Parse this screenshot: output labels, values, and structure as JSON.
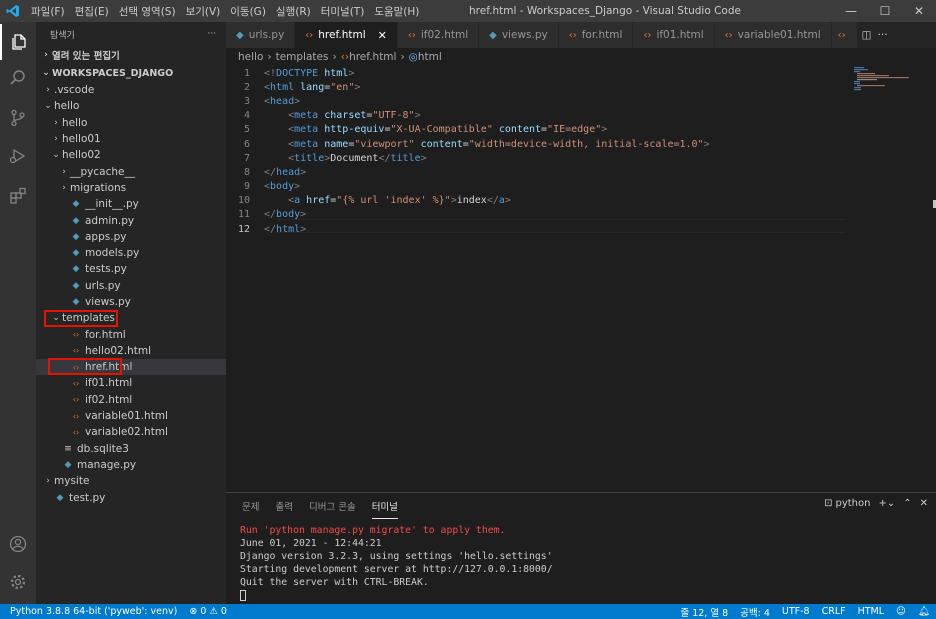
{
  "window": {
    "title": "href.html - Workspaces_Django - Visual Studio Code",
    "menu": [
      "파일(F)",
      "편집(E)",
      "선택 영역(S)",
      "보기(V)",
      "이동(G)",
      "실행(R)",
      "터미널(T)",
      "도움말(H)"
    ]
  },
  "sidebar": {
    "header": "탐색기",
    "more": "···",
    "open_editors": "열려 있는 편집기",
    "workspace": "WORKSPACES_DJANGO",
    "tree": [
      {
        "label": ".vscode",
        "depth": 0,
        "kind": "folder",
        "open": false
      },
      {
        "label": "hello",
        "depth": 0,
        "kind": "folder",
        "open": true
      },
      {
        "label": "hello",
        "depth": 1,
        "kind": "folder",
        "open": false
      },
      {
        "label": "hello01",
        "depth": 1,
        "kind": "folder",
        "open": false
      },
      {
        "label": "hello02",
        "depth": 1,
        "kind": "folder",
        "open": true
      },
      {
        "label": "__pycache__",
        "depth": 2,
        "kind": "folder",
        "open": false
      },
      {
        "label": "migrations",
        "depth": 2,
        "kind": "folder",
        "open": false
      },
      {
        "label": "__init__.py",
        "depth": 2,
        "kind": "py"
      },
      {
        "label": "admin.py",
        "depth": 2,
        "kind": "py"
      },
      {
        "label": "apps.py",
        "depth": 2,
        "kind": "py"
      },
      {
        "label": "models.py",
        "depth": 2,
        "kind": "py"
      },
      {
        "label": "tests.py",
        "depth": 2,
        "kind": "py"
      },
      {
        "label": "urls.py",
        "depth": 2,
        "kind": "py"
      },
      {
        "label": "views.py",
        "depth": 2,
        "kind": "py"
      },
      {
        "label": "templates",
        "depth": 1,
        "kind": "folder",
        "open": true
      },
      {
        "label": "for.html",
        "depth": 2,
        "kind": "html"
      },
      {
        "label": "hello02.html",
        "depth": 2,
        "kind": "html"
      },
      {
        "label": "href.html",
        "depth": 2,
        "kind": "html",
        "selected": true
      },
      {
        "label": "if01.html",
        "depth": 2,
        "kind": "html"
      },
      {
        "label": "if02.html",
        "depth": 2,
        "kind": "html"
      },
      {
        "label": "variable01.html",
        "depth": 2,
        "kind": "html"
      },
      {
        "label": "variable02.html",
        "depth": 2,
        "kind": "html"
      },
      {
        "label": "db.sqlite3",
        "depth": 1,
        "kind": "db"
      },
      {
        "label": "manage.py",
        "depth": 1,
        "kind": "py"
      },
      {
        "label": "mysite",
        "depth": 0,
        "kind": "folder",
        "open": false
      },
      {
        "label": "test.py",
        "depth": 0,
        "kind": "py"
      }
    ]
  },
  "tabs": [
    {
      "label": "urls.py",
      "kind": "py"
    },
    {
      "label": "href.html",
      "kind": "html",
      "active": true
    },
    {
      "label": "if02.html",
      "kind": "html"
    },
    {
      "label": "views.py",
      "kind": "py"
    },
    {
      "label": "for.html",
      "kind": "html"
    },
    {
      "label": "if01.html",
      "kind": "html"
    },
    {
      "label": "variable01.html",
      "kind": "html"
    },
    {
      "label": "",
      "kind": "html"
    }
  ],
  "breadcrumb": [
    "hello",
    "templates",
    "href.html",
    "html"
  ],
  "code": [
    [
      {
        "c": "t-br",
        "t": "<!"
      },
      {
        "c": "t-tag",
        "t": "DOCTYPE"
      },
      {
        "c": "t-attr",
        "t": " html"
      },
      {
        "c": "t-br",
        "t": ">"
      }
    ],
    [
      {
        "c": "t-br",
        "t": "<"
      },
      {
        "c": "t-tag",
        "t": "html"
      },
      {
        "c": "t-attr",
        "t": " lang"
      },
      {
        "c": "t-txt",
        "t": "="
      },
      {
        "c": "t-str",
        "t": "\"en\""
      },
      {
        "c": "t-br",
        "t": ">"
      }
    ],
    [
      {
        "c": "t-br",
        "t": "<"
      },
      {
        "c": "t-tag",
        "t": "head"
      },
      {
        "c": "t-br",
        "t": ">"
      }
    ],
    [
      {
        "c": "t-txt",
        "t": "    "
      },
      {
        "c": "t-br",
        "t": "<"
      },
      {
        "c": "t-tag",
        "t": "meta"
      },
      {
        "c": "t-attr",
        "t": " charset"
      },
      {
        "c": "t-txt",
        "t": "="
      },
      {
        "c": "t-str",
        "t": "\"UTF-8\""
      },
      {
        "c": "t-br",
        "t": ">"
      }
    ],
    [
      {
        "c": "t-txt",
        "t": "    "
      },
      {
        "c": "t-br",
        "t": "<"
      },
      {
        "c": "t-tag",
        "t": "meta"
      },
      {
        "c": "t-attr",
        "t": " http-equiv"
      },
      {
        "c": "t-txt",
        "t": "="
      },
      {
        "c": "t-str",
        "t": "\"X-UA-Compatible\""
      },
      {
        "c": "t-attr",
        "t": " content"
      },
      {
        "c": "t-txt",
        "t": "="
      },
      {
        "c": "t-str",
        "t": "\"IE=edge\""
      },
      {
        "c": "t-br",
        "t": ">"
      }
    ],
    [
      {
        "c": "t-txt",
        "t": "    "
      },
      {
        "c": "t-br",
        "t": "<"
      },
      {
        "c": "t-tag",
        "t": "meta"
      },
      {
        "c": "t-attr",
        "t": " name"
      },
      {
        "c": "t-txt",
        "t": "="
      },
      {
        "c": "t-str",
        "t": "\"viewport\""
      },
      {
        "c": "t-attr",
        "t": " content"
      },
      {
        "c": "t-txt",
        "t": "="
      },
      {
        "c": "t-str",
        "t": "\"width=device-width, initial-scale=1.0\""
      },
      {
        "c": "t-br",
        "t": ">"
      }
    ],
    [
      {
        "c": "t-txt",
        "t": "    "
      },
      {
        "c": "t-br",
        "t": "<"
      },
      {
        "c": "t-tag",
        "t": "title"
      },
      {
        "c": "t-br",
        "t": ">"
      },
      {
        "c": "t-txt",
        "t": "Document"
      },
      {
        "c": "t-br",
        "t": "</"
      },
      {
        "c": "t-tag",
        "t": "title"
      },
      {
        "c": "t-br",
        "t": ">"
      }
    ],
    [
      {
        "c": "t-br",
        "t": "</"
      },
      {
        "c": "t-tag",
        "t": "head"
      },
      {
        "c": "t-br",
        "t": ">"
      }
    ],
    [
      {
        "c": "t-br",
        "t": "<"
      },
      {
        "c": "t-tag",
        "t": "body"
      },
      {
        "c": "t-br",
        "t": ">"
      }
    ],
    [
      {
        "c": "t-txt",
        "t": "    "
      },
      {
        "c": "t-br",
        "t": "<"
      },
      {
        "c": "t-tag",
        "t": "a"
      },
      {
        "c": "t-attr",
        "t": " href"
      },
      {
        "c": "t-txt",
        "t": "="
      },
      {
        "c": "t-str",
        "t": "\"{% url 'index' %}\""
      },
      {
        "c": "t-br",
        "t": ">"
      },
      {
        "c": "t-txt",
        "t": "index"
      },
      {
        "c": "t-br",
        "t": "</"
      },
      {
        "c": "t-tag",
        "t": "a"
      },
      {
        "c": "t-br",
        "t": ">"
      }
    ],
    [
      {
        "c": "t-br",
        "t": "</"
      },
      {
        "c": "t-tag",
        "t": "body"
      },
      {
        "c": "t-br",
        "t": ">"
      }
    ],
    [
      {
        "c": "t-br",
        "t": "</"
      },
      {
        "c": "t-tag",
        "t": "html"
      },
      {
        "c": "t-br",
        "t": ">"
      }
    ]
  ],
  "current_line": 12,
  "panel": {
    "tabs": [
      "문제",
      "출력",
      "디버그 콘솔",
      "터미널"
    ],
    "active_tab": 3,
    "terminal_name": "python",
    "terminal": [
      {
        "t": "Run 'python manage.py migrate' to apply them.",
        "red": true
      },
      {
        "t": "June 01, 2021 - 12:44:21"
      },
      {
        "t": "Django version 3.2.3, using settings 'hello.settings'"
      },
      {
        "t": "Starting development server at http://127.0.0.1:8000/"
      },
      {
        "t": "Quit the server with CTRL-BREAK."
      }
    ]
  },
  "status": {
    "interpreter": "Python 3.8.8 64-bit ('pyweb': venv)",
    "problems": "⊗ 0 ⚠ 0",
    "position": "줄 12, 열 8",
    "spaces": "공백: 4",
    "encoding": "UTF-8",
    "eol": "CRLF",
    "language": "HTML"
  },
  "colors": {
    "accent": "#007acc",
    "highlight_box": "#e51400",
    "py_icon": "#519aba",
    "html_icon": "#e37933"
  }
}
